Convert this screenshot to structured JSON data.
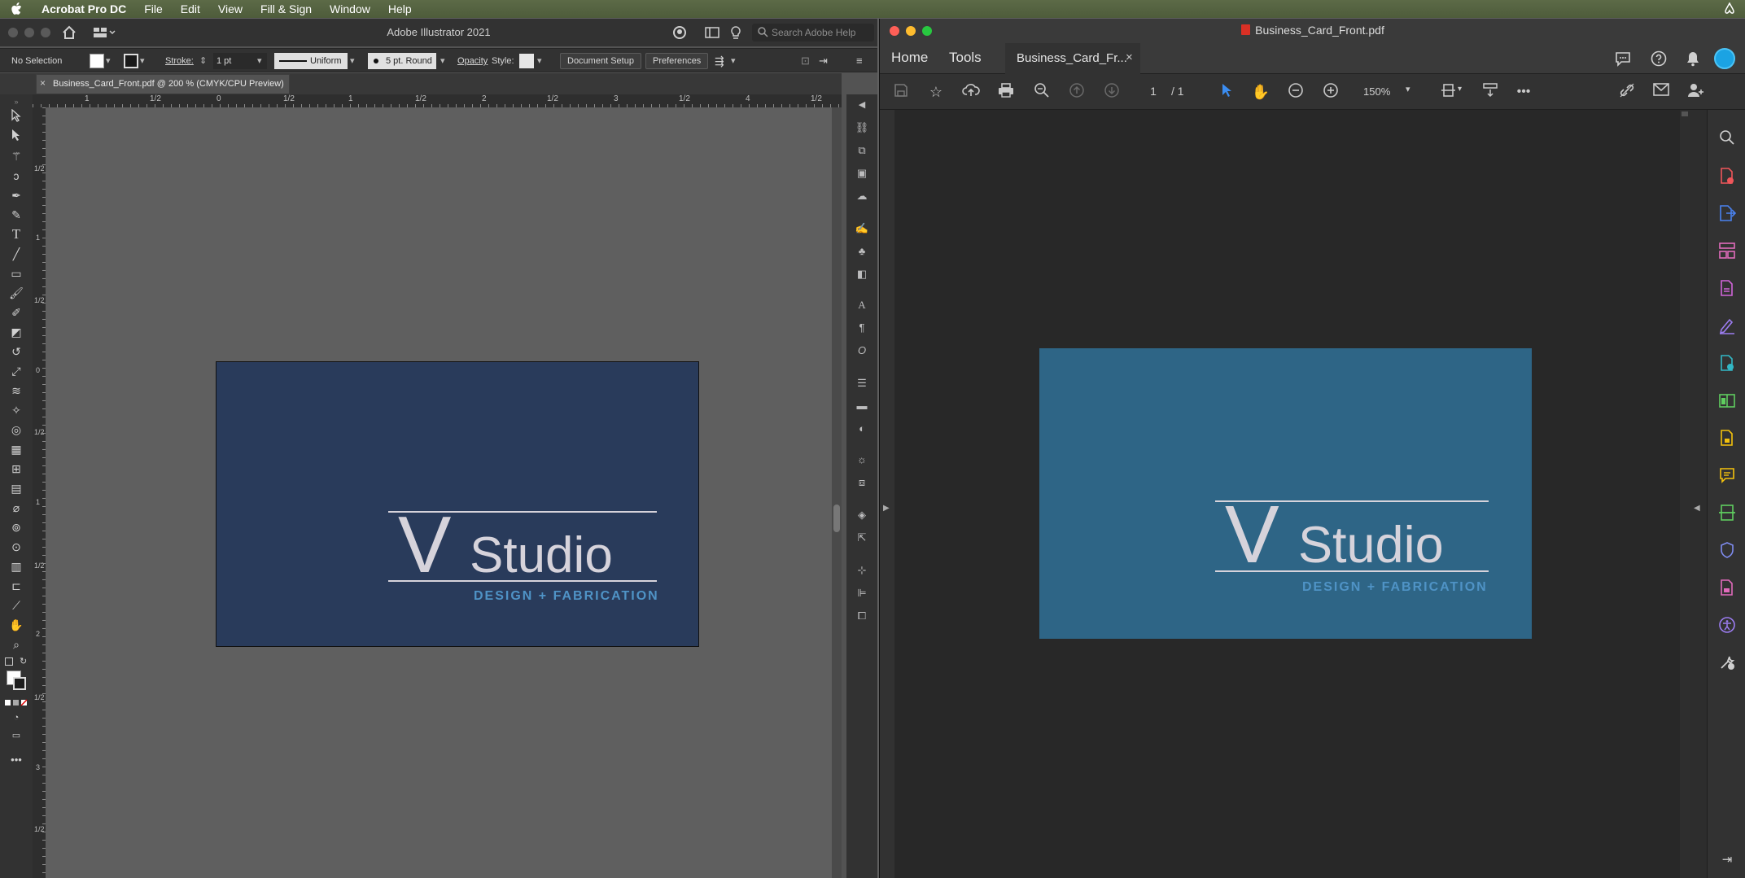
{
  "menubar": {
    "app_name": "Acrobat Pro DC",
    "items": [
      "File",
      "Edit",
      "View",
      "Fill & Sign",
      "Window",
      "Help"
    ]
  },
  "illustrator": {
    "window_title": "Adobe Illustrator 2021",
    "search_placeholder": "Search Adobe Help",
    "control_bar": {
      "selection": "No Selection",
      "stroke_label": "Stroke:",
      "stroke_value": "1 pt",
      "profile": "Uniform",
      "brush": "5 pt. Round",
      "opacity_label": "Opacity",
      "style_label": "Style:",
      "document_setup": "Document Setup",
      "preferences": "Preferences"
    },
    "doc_tab": "Business_Card_Front.pdf @ 200 % (CMYK/CPU Preview)",
    "ruler_top": [
      "1",
      "1/2",
      "0",
      "1/2",
      "1",
      "1/2",
      "2",
      "1/2",
      "3",
      "1/2",
      "4",
      "1/2"
    ],
    "ruler_left": [
      "1/2",
      "1",
      "1/2",
      "0",
      "1/2",
      "1",
      "1/2",
      "2",
      "1/2",
      "3",
      "1/2"
    ]
  },
  "card": {
    "letter_v": "V",
    "studio": "Studio",
    "tagline": "DESIGN + FABRICATION",
    "colors": {
      "ai_bg": "#293b5b",
      "pdf_bg": "#2e6586",
      "logo": "#d6d3db",
      "tagline": "#4f93c6"
    }
  },
  "acrobat": {
    "window_title": "Business_Card_Front.pdf",
    "tabs": {
      "home": "Home",
      "tools": "Tools",
      "document": "Business_Card_Fr..."
    },
    "page_current": "1",
    "page_total": "/ 1",
    "zoom": "150%"
  }
}
